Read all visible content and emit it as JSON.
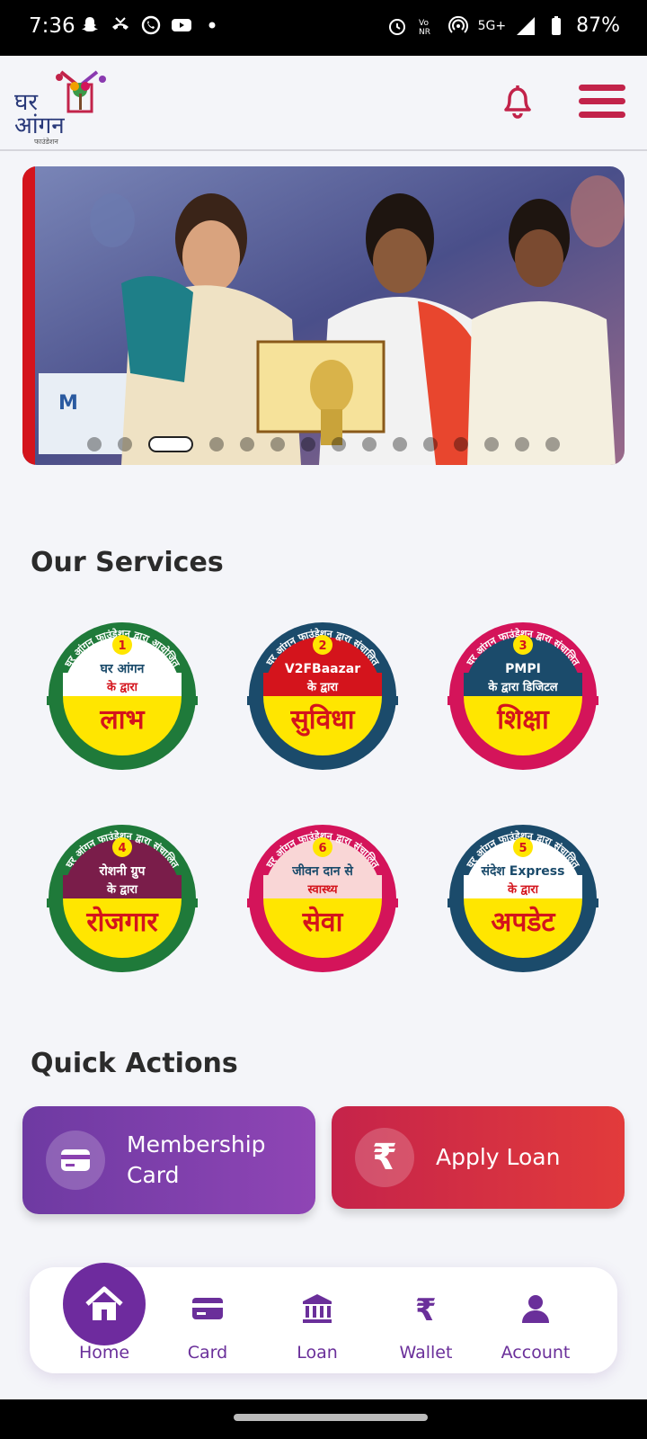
{
  "status_bar": {
    "time": "7:36",
    "network": "5G+",
    "battery": "87%"
  },
  "header": {
    "logo_text_top": "घर",
    "logo_text_bottom": "आंगन",
    "logo_sub": "फाउंडेशन",
    "icons": [
      "bell-icon",
      "menu-icon"
    ]
  },
  "banner": {
    "dots_count": 16,
    "active_index": 2
  },
  "services": {
    "title": "Our Services",
    "items": [
      {
        "number": "1",
        "arc_text": "घर आंगन फाउंडेशन द्वारा आयोजित",
        "brand": "घर आंगन",
        "line1": "के द्वारा",
        "main": "लाभ",
        "arc_color": "#1f7a3a",
        "top_color": "#ffffff",
        "bottom_color": "#ffe600",
        "text_color": "#d4141c"
      },
      {
        "number": "2",
        "arc_text": "घर आंगन फाउंडेशन द्वारा संचालित",
        "brand": "V2FBaazar",
        "line1": "के द्वारा",
        "main": "सुविधा",
        "arc_color": "#1b4b6b",
        "top_color": "#d4141c",
        "bottom_color": "#ffe600",
        "text_color": "#d4141c"
      },
      {
        "number": "3",
        "arc_text": "घर आंगन फाउंडेशन द्वारा संचालित",
        "brand": "PMPI",
        "line1": "के द्वारा डिजिटल",
        "main": "शिक्षा",
        "arc_color": "#d4145a",
        "top_color": "#1b4b6b",
        "bottom_color": "#ffe600",
        "text_color": "#d4141c"
      },
      {
        "number": "4",
        "arc_text": "घर आंगन फाउंडेशन द्वारा संचालित",
        "brand": "रोशनी ग्रुप",
        "line1": "के द्वारा",
        "main": "रोजगार",
        "arc_color": "#1f7a3a",
        "top_color": "#7a1d4a",
        "bottom_color": "#ffe600",
        "text_color": "#d4141c"
      },
      {
        "number": "6",
        "arc_text": "घर आंगन फाउंडेशन द्वारा संचालित",
        "brand": "जीवन दान से",
        "line1": "स्वास्थ्य",
        "main": "सेवा",
        "arc_color": "#d4145a",
        "top_color": "#f9d6d6",
        "bottom_color": "#ffe600",
        "text_color": "#d4141c"
      },
      {
        "number": "5",
        "arc_text": "घर आंगन फाउंडेशन द्वारा संचालित",
        "brand": "संदेश Express",
        "line1": "के द्वारा",
        "main": "अपडेट",
        "arc_color": "#1b4b6b",
        "top_color": "#ffffff",
        "bottom_color": "#ffe600",
        "text_color": "#d4141c"
      }
    ]
  },
  "quick_actions": {
    "title": "Quick Actions",
    "membership_label_1": "Membership",
    "membership_label_2": "Card",
    "loan_label": "Apply Loan",
    "rupee_symbol": "₹"
  },
  "bottom_nav": {
    "items": [
      {
        "label": "Home",
        "icon": "home-icon",
        "active": true
      },
      {
        "label": "Card",
        "icon": "card-icon"
      },
      {
        "label": "Loan",
        "icon": "bank-icon"
      },
      {
        "label": "Wallet",
        "icon": "rupee-icon"
      },
      {
        "label": "Account",
        "icon": "user-icon"
      }
    ],
    "accent": "#6e2b9e"
  }
}
